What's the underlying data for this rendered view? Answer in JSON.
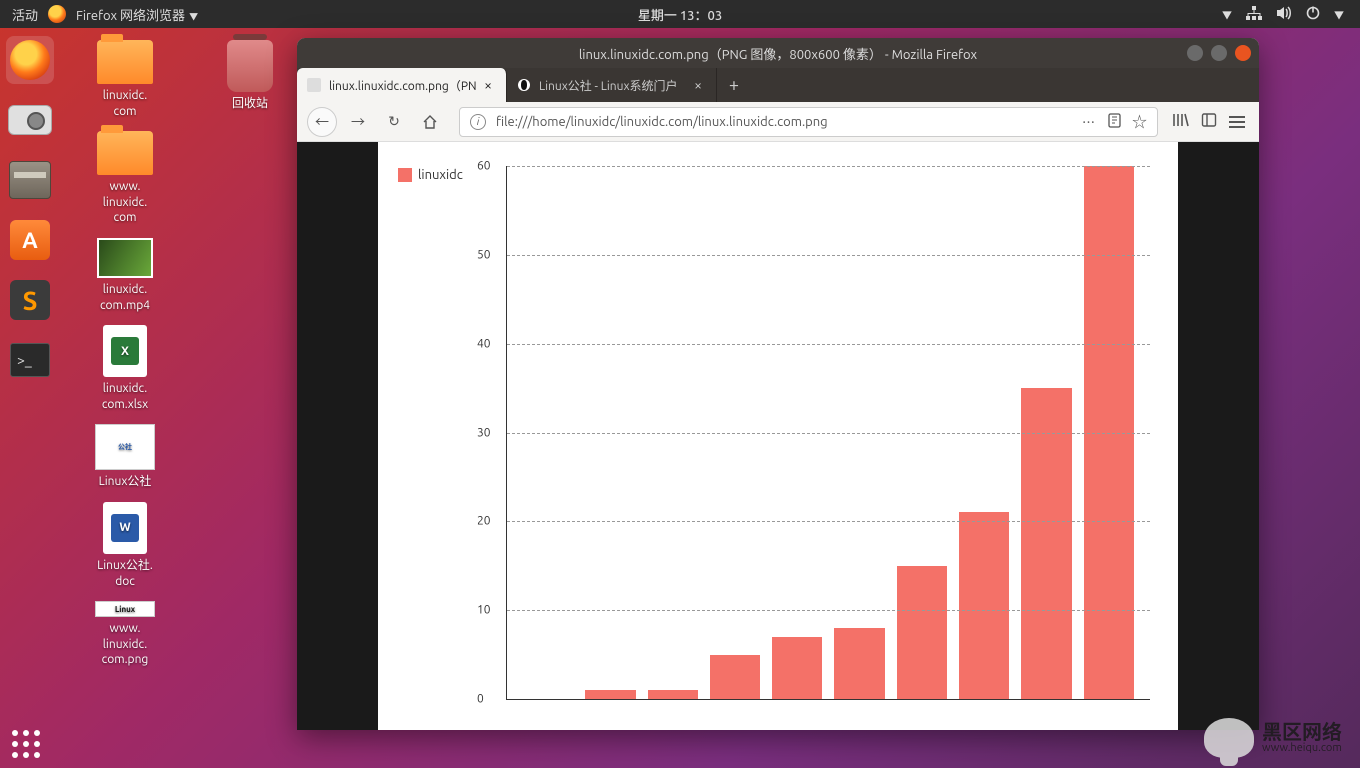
{
  "topbar": {
    "activities": "活动",
    "app_label": "Firefox 网络浏览器",
    "clock": "星期一 13：03"
  },
  "desktop_icons": {
    "col1": [
      {
        "label": "linuxidc.\ncom",
        "type": "folder"
      },
      {
        "label": "www.\nlinuxidc.\ncom",
        "type": "folder"
      },
      {
        "label": "linuxidc.\ncom.mp4",
        "type": "video"
      },
      {
        "label": "linuxidc.\ncom.xlsx",
        "type": "xlsx"
      },
      {
        "label": "Linux公社",
        "type": "png",
        "thumb_text": "公社"
      },
      {
        "label": "Linux公社.\ndoc",
        "type": "doc"
      },
      {
        "label": "www.\nlinuxidc.\ncom.png",
        "type": "png2",
        "thumb_text": "Linux"
      }
    ],
    "col2": [
      {
        "label": "回收站",
        "type": "trash"
      }
    ]
  },
  "window": {
    "title": "linux.linuxidc.com.png（PNG 图像，800x600 像素） - Mozilla Firefox",
    "tabs": [
      {
        "label": "linux.linuxidc.com.png（PN",
        "active": true
      },
      {
        "label": "Linux公社 - Linux系统门户",
        "active": false
      }
    ],
    "url": "file:///home/linuxidc/linuxidc.com/linux.linuxidc.com.png"
  },
  "chart_data": {
    "type": "bar",
    "legend": "linuxidc",
    "yticks": [
      0,
      10,
      20,
      30,
      40,
      50,
      60
    ],
    "ylim": [
      0,
      60
    ],
    "values": [
      0,
      1,
      1,
      5,
      7,
      8,
      15,
      21,
      35,
      60
    ],
    "bar_color": "#f47168"
  },
  "watermark": {
    "line1": "黑区网络",
    "line2": "www.heiqu.com"
  }
}
